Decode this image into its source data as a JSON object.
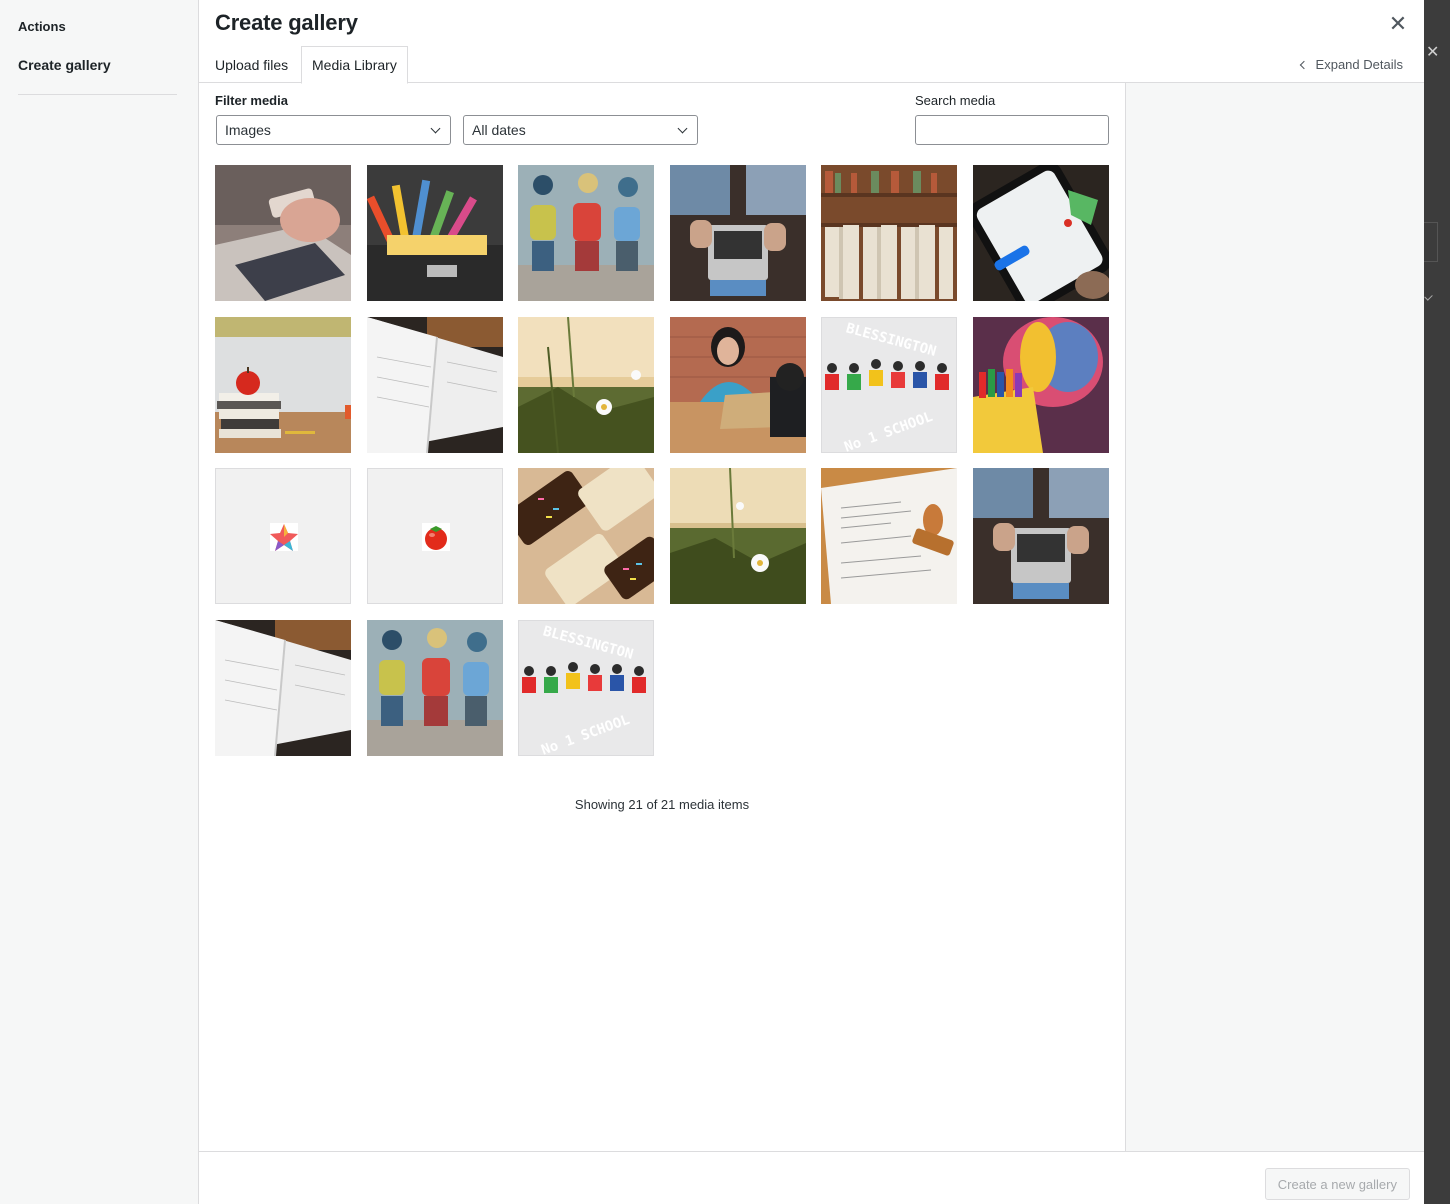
{
  "sidebar": {
    "heading": "Actions",
    "items": [
      {
        "label": "Create gallery"
      }
    ]
  },
  "modal": {
    "title": "Create gallery",
    "tabs": [
      {
        "label": "Upload files"
      },
      {
        "label": "Media Library",
        "active": true
      }
    ],
    "expand_details": "Expand Details",
    "filter": {
      "label": "Filter media",
      "type_value": "Images",
      "date_value": "All dates"
    },
    "search": {
      "label": "Search media",
      "value": "",
      "placeholder": ""
    },
    "media_items": [
      {
        "subject": "laptop-phone"
      },
      {
        "subject": "office-supplies"
      },
      {
        "subject": "school-children"
      },
      {
        "subject": "laptop-hands"
      },
      {
        "subject": "bookshelf"
      },
      {
        "subject": "map-phone"
      },
      {
        "subject": "apple-books"
      },
      {
        "subject": "open-planner"
      },
      {
        "subject": "daisy-field"
      },
      {
        "subject": "woman-laptop"
      },
      {
        "subject": "school-logo"
      },
      {
        "subject": "crayons"
      },
      {
        "subject": "star-icon"
      },
      {
        "subject": "tomato-icon"
      },
      {
        "subject": "rice-crispy-treats"
      },
      {
        "subject": "daisy-field"
      },
      {
        "subject": "document-stamp"
      },
      {
        "subject": "laptop-hands"
      },
      {
        "subject": "open-planner"
      },
      {
        "subject": "school-children"
      },
      {
        "subject": "school-logo"
      }
    ],
    "logo_text_top": "BLESSINGTON",
    "logo_text_bottom": "No 1 SCHOOL",
    "showing_text": "Showing 21 of 21 media items",
    "create_button": "Create a new gallery"
  },
  "colors": {
    "accent": "#2271b1",
    "text": "#1d2327",
    "border": "#dcdcde",
    "disabled_text": "#a7aaad"
  }
}
